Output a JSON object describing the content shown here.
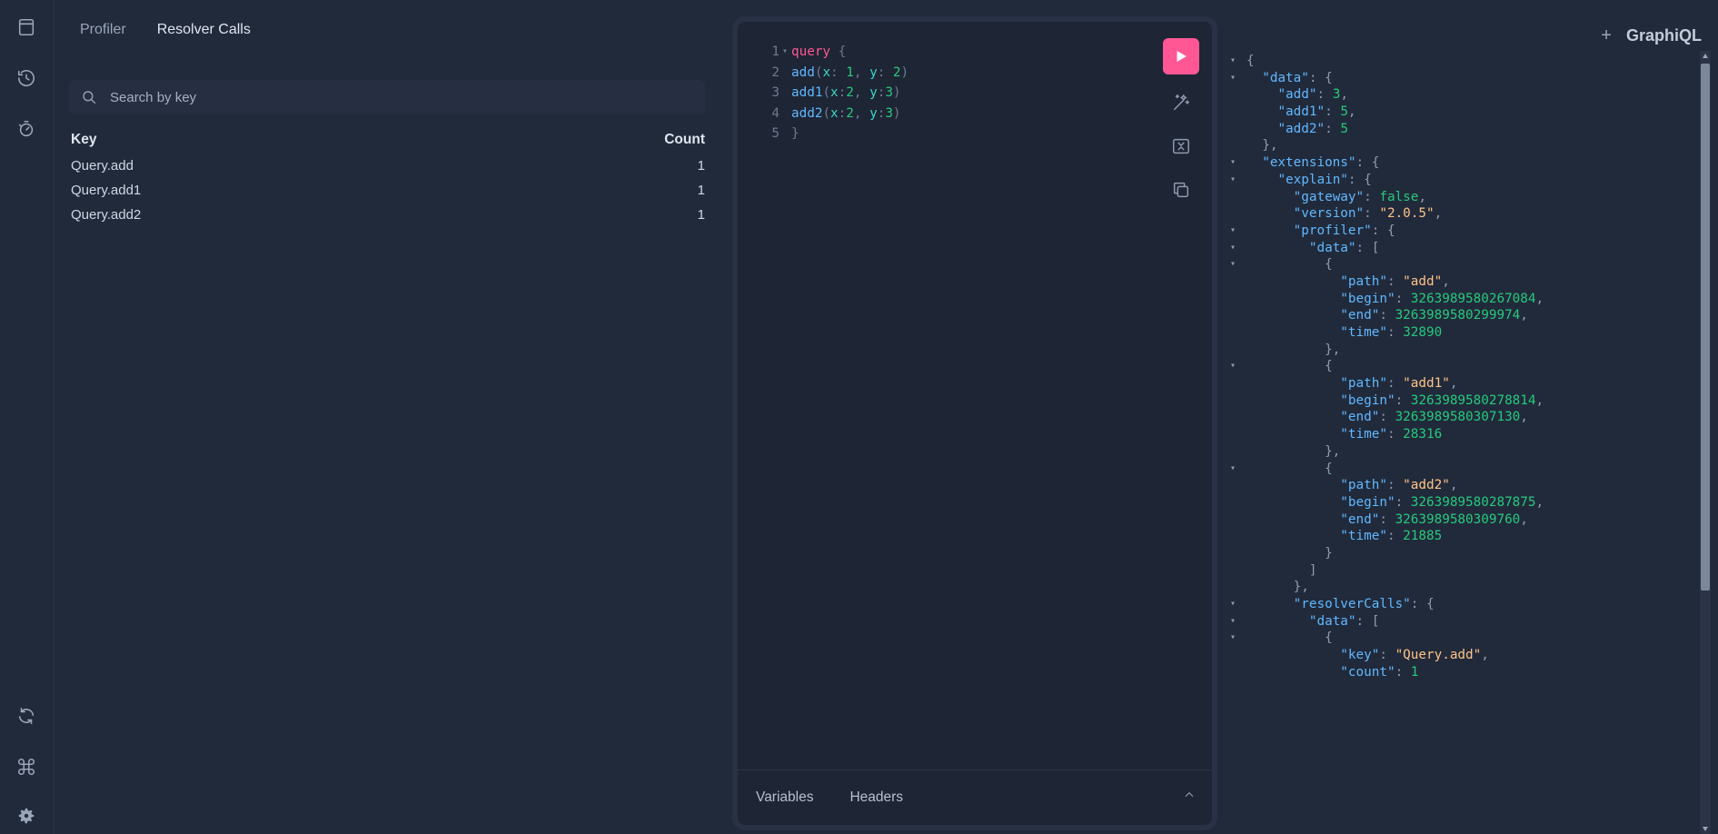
{
  "plugin": {
    "tabs": [
      "Profiler",
      "Resolver Calls"
    ],
    "active_tab": "Resolver Calls",
    "search": {
      "placeholder": "Search by key",
      "value": ""
    },
    "table": {
      "headers": {
        "key": "Key",
        "count": "Count"
      },
      "rows": [
        {
          "key": "Query.add",
          "count": "1"
        },
        {
          "key": "Query.add1",
          "count": "1"
        },
        {
          "key": "Query.add2",
          "count": "1"
        }
      ]
    }
  },
  "editor": {
    "bottom_tabs": [
      "Variables",
      "Headers"
    ]
  },
  "result": {
    "brand": "GraphiQL",
    "values": {
      "add": "3",
      "add1": "5",
      "add2": "5",
      "gateway": "false",
      "version": "\"2.0.5\"",
      "p0_path": "\"add\"",
      "p0_begin": "3263989580267084",
      "p0_end": "3263989580299974",
      "p0_time": "32890",
      "p1_path": "\"add1\"",
      "p1_begin": "3263989580278814",
      "p1_end": "3263989580307130",
      "p1_time": "28316",
      "p2_path": "\"add2\"",
      "p2_begin": "3263989580287875",
      "p2_end": "3263989580309760",
      "p2_time": "21885",
      "rc_key": "\"Query.add\"",
      "rc_count": "1"
    }
  },
  "icons": {
    "rail_top": [
      "docs-icon",
      "history-icon",
      "profiler-icon"
    ],
    "rail_bottom": [
      "refetch-icon",
      "shortcut-icon",
      "settings-icon"
    ],
    "toolbar": [
      "prettify-icon",
      "merge-icon",
      "copy-icon"
    ]
  },
  "colors": {
    "accent": "#ff5794",
    "background": "#212a3b"
  }
}
